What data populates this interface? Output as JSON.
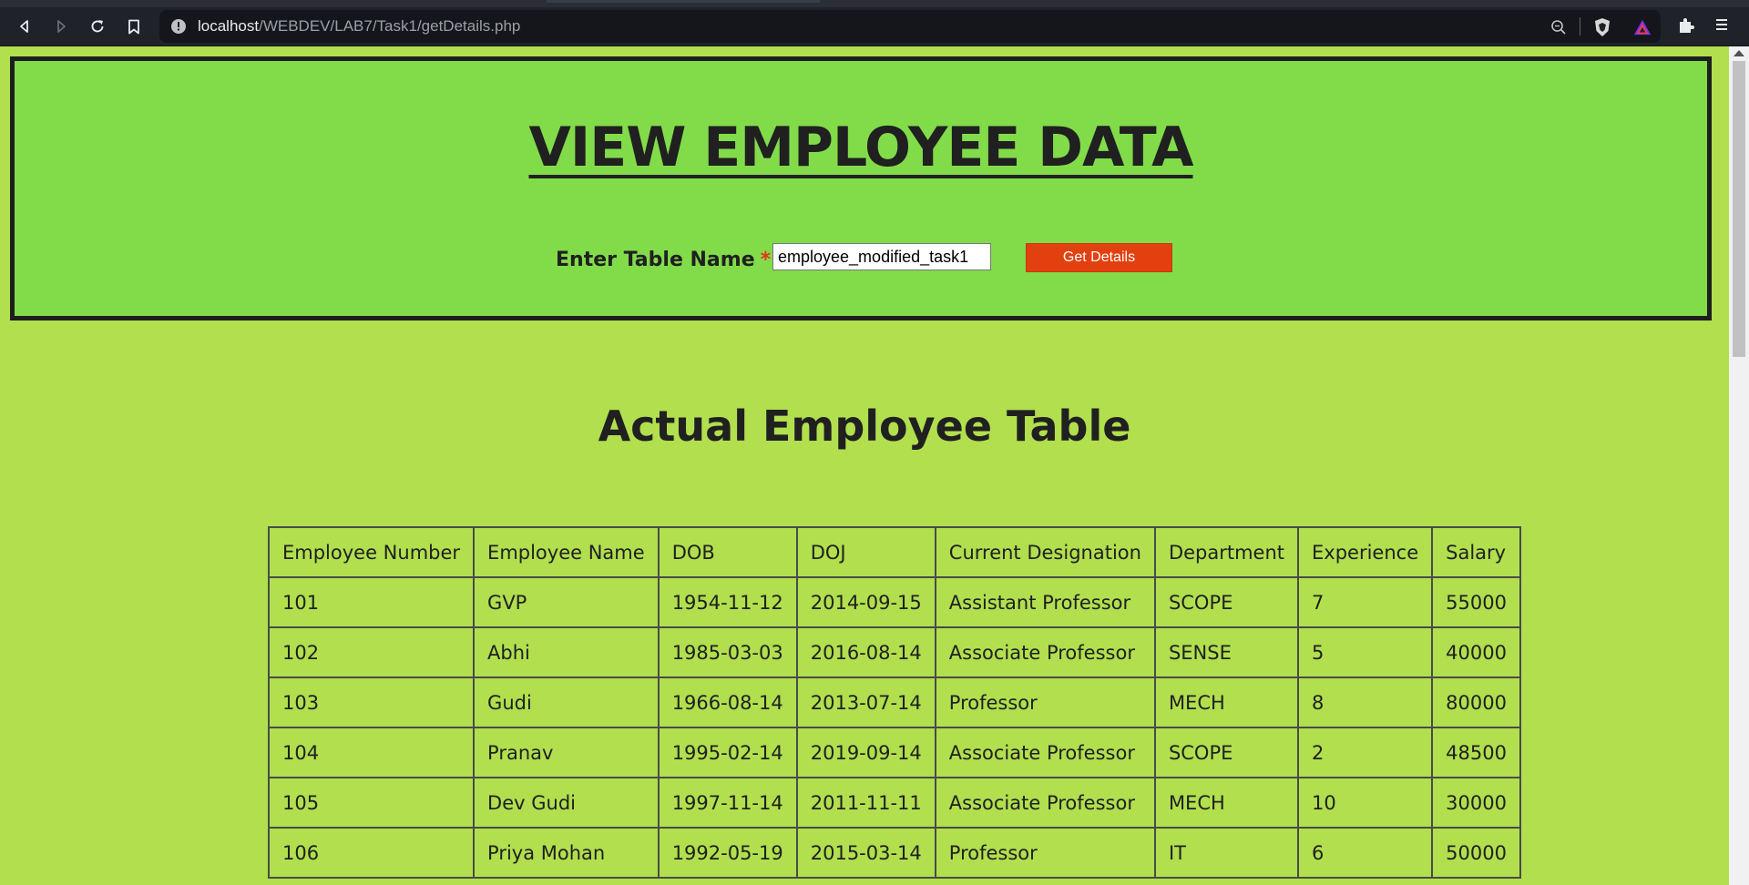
{
  "browser": {
    "url_host": "localhost",
    "url_path": "/WEBDEV/LAB7/Task1/getDetails.php",
    "colors": {
      "toolbar": "#202229",
      "urlbar": "#15161b"
    },
    "icons": [
      "back-icon",
      "forward-icon",
      "reload-icon",
      "bookmark-icon",
      "info-icon",
      "zoom-icon",
      "brave-shield-icon",
      "brave-rewards-icon",
      "extensions-icon",
      "menu-icon"
    ]
  },
  "header": {
    "title": "VIEW EMPLOYEE DATA",
    "form_label": "Enter Table Name",
    "required_mark": "*",
    "table_input_value": "employee_modified_task1",
    "submit_label": "Get Details"
  },
  "section": {
    "title": "Actual Employee Table"
  },
  "table": {
    "headers": [
      "Employee Number",
      "Employee Name",
      "DOB",
      "DOJ",
      "Current Designation",
      "Department",
      "Experience",
      "Salary"
    ],
    "rows": [
      [
        "101",
        "GVP",
        "1954-11-12",
        "2014-09-15",
        "Assistant Professor",
        "SCOPE",
        "7",
        "55000"
      ],
      [
        "102",
        "Abhi",
        "1985-03-03",
        "2016-08-14",
        "Associate Professor",
        "SENSE",
        "5",
        "40000"
      ],
      [
        "103",
        "Gudi",
        "1966-08-14",
        "2013-07-14",
        "Professor",
        "MECH",
        "8",
        "80000"
      ],
      [
        "104",
        "Pranav",
        "1995-02-14",
        "2019-09-14",
        "Associate Professor",
        "SCOPE",
        "2",
        "48500"
      ],
      [
        "105",
        "Dev Gudi",
        "1997-11-14",
        "2011-11-11",
        "Associate Professor",
        "MECH",
        "10",
        "30000"
      ],
      [
        "106",
        "Priya Mohan",
        "1992-05-19",
        "2015-03-14",
        "Professor",
        "IT",
        "6",
        "50000"
      ]
    ]
  },
  "colors": {
    "page_bg": "#b1df4e",
    "header_bg": "#82dc4a",
    "button_bg": "#e2400f",
    "required": "#e8321a"
  }
}
